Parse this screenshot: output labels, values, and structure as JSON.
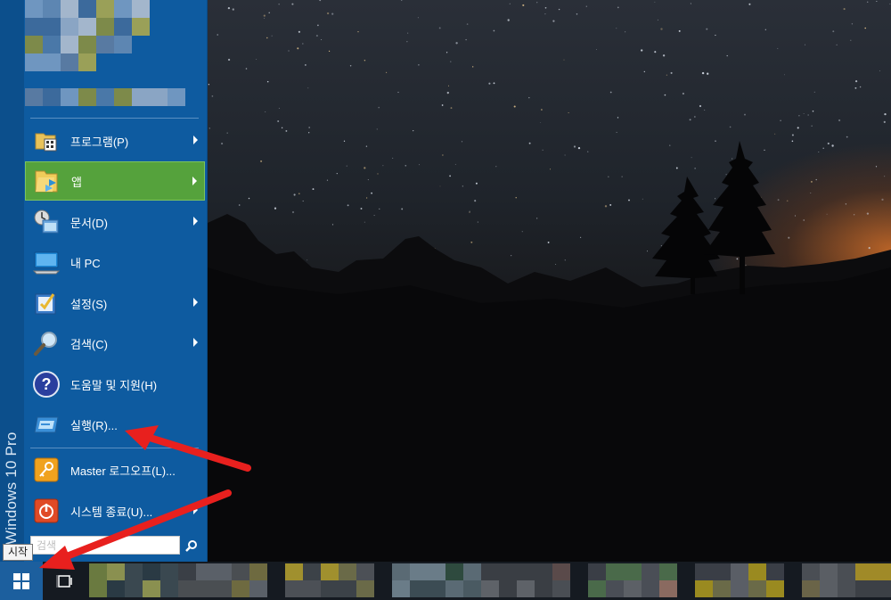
{
  "start_menu": {
    "brand": "Windows 10 Pro",
    "items": [
      {
        "label": "프로그램(P)",
        "icon": "programs-folder-icon",
        "has_submenu": true
      },
      {
        "label": "앱",
        "icon": "apps-folder-icon",
        "has_submenu": true,
        "active": true
      },
      {
        "label": "문서(D)",
        "icon": "documents-icon",
        "has_submenu": true
      },
      {
        "label": "내 PC",
        "icon": "computer-icon",
        "has_submenu": false
      },
      {
        "label": "설정(S)",
        "icon": "settings-icon",
        "has_submenu": true
      },
      {
        "label": "검색(C)",
        "icon": "search-magnifier-icon",
        "has_submenu": true
      },
      {
        "label": "도움말 및 지원(H)",
        "icon": "help-icon",
        "has_submenu": false
      },
      {
        "label": "실행(R)...",
        "icon": "run-icon",
        "has_submenu": false
      },
      {
        "label": "Master 로그오프(L)...",
        "icon": "logoff-key-icon",
        "has_submenu": false
      },
      {
        "label": "시스템 종료(U)...",
        "icon": "shutdown-icon",
        "has_submenu": true
      }
    ],
    "search": {
      "placeholder": "검색",
      "value": ""
    }
  },
  "taskbar": {
    "start_tooltip": "시작"
  },
  "colors": {
    "menu_bg": "#0e5ba0",
    "active_item": "#55a23c",
    "taskbar_bg": "#151a21",
    "annotation_arrow": "#e8201e"
  }
}
